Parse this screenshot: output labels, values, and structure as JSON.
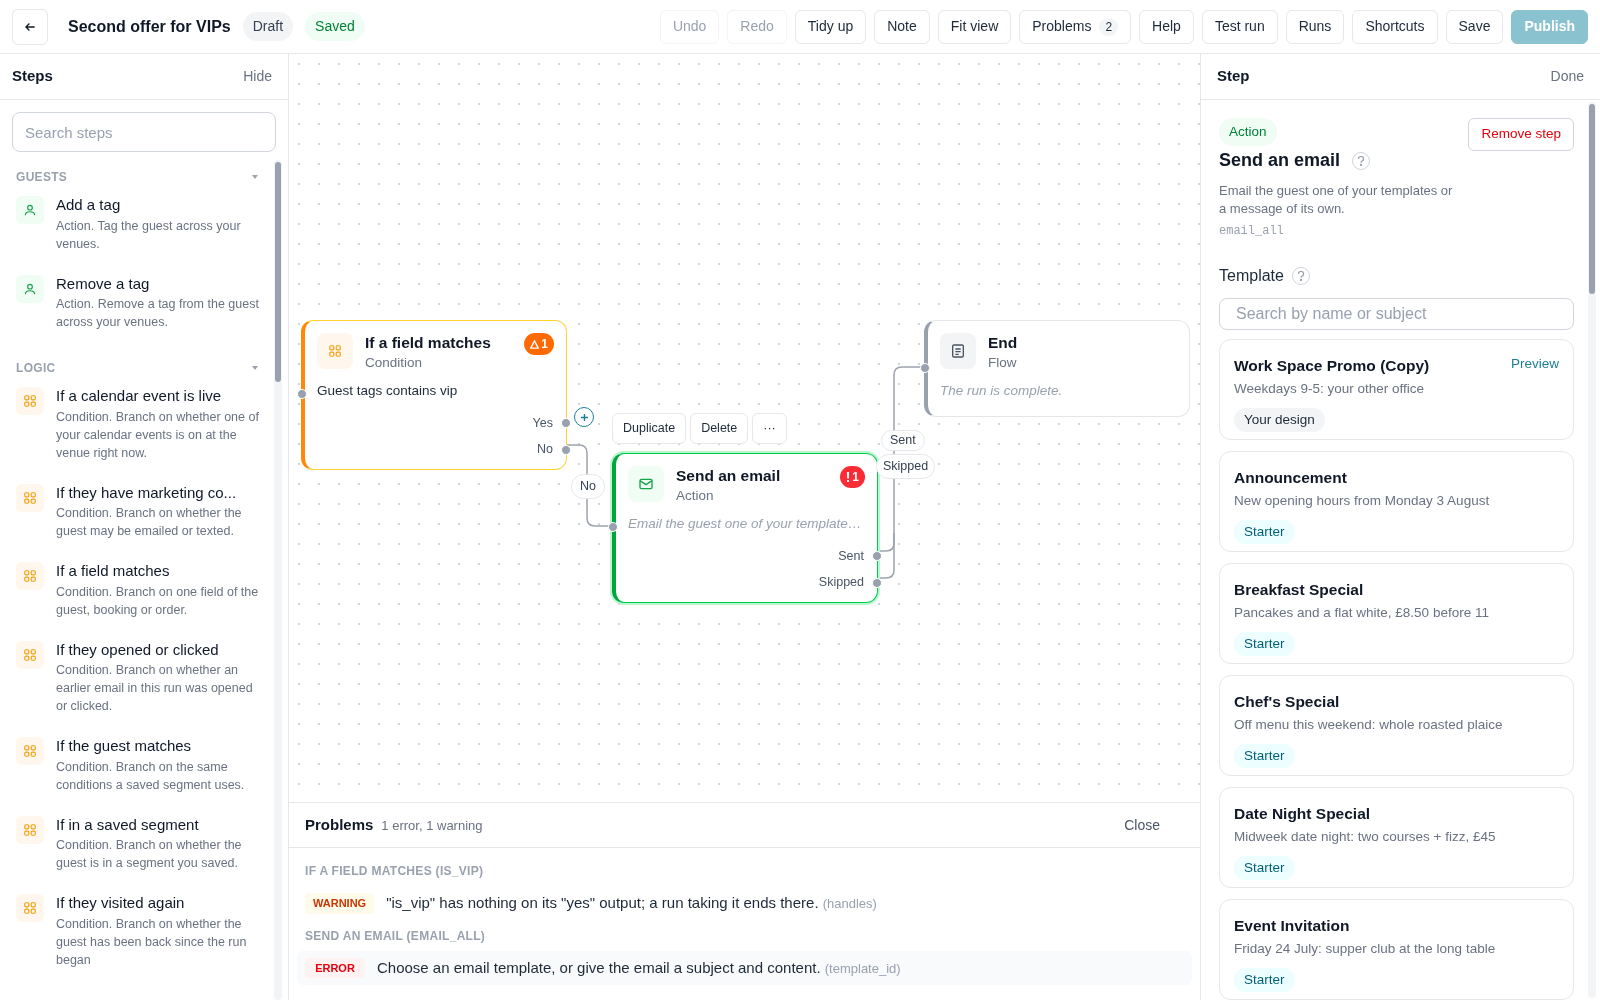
{
  "header": {
    "title": "Second offer for VIPs",
    "badges": [
      {
        "label": "Draft",
        "kind": "neutral"
      },
      {
        "label": "Saved",
        "kind": "success"
      }
    ],
    "buttons": [
      {
        "label": "Undo",
        "disabled": true
      },
      {
        "label": "Redo",
        "disabled": true
      },
      {
        "label": "Tidy up",
        "disabled": false
      },
      {
        "label": "Note",
        "disabled": false
      },
      {
        "label": "Fit view",
        "disabled": false
      },
      {
        "label": "Problems",
        "disabled": false,
        "count": "2"
      },
      {
        "label": "Help",
        "disabled": false
      },
      {
        "label": "Test run",
        "disabled": false
      },
      {
        "label": "Runs",
        "disabled": false
      },
      {
        "label": "Shortcuts",
        "disabled": false
      },
      {
        "label": "Save",
        "disabled": false
      },
      {
        "label": "Publish",
        "disabled": true,
        "kind": "primary"
      }
    ]
  },
  "sidebar": {
    "title": "Steps",
    "hide": "Hide",
    "search": {
      "placeholder": "Search steps"
    },
    "sections": [
      {
        "label": "GUESTS",
        "items": [
          {
            "kind": "action",
            "title": "Add a tag",
            "desc": "Action. Tag the guest across your venues."
          },
          {
            "kind": "action",
            "title": "Remove a tag",
            "desc": "Action. Remove a tag from the guest across your venues."
          }
        ]
      },
      {
        "label": "LOGIC",
        "items": [
          {
            "kind": "condition",
            "title": "If a calendar event is live",
            "desc": "Condition. Branch on whether one of your calendar events is on at the venue right now."
          },
          {
            "kind": "condition",
            "title": "If they have marketing co...",
            "desc": "Condition. Branch on whether the guest may be emailed or texted."
          },
          {
            "kind": "condition",
            "title": "If a field matches",
            "desc": "Condition. Branch on one field of the guest, booking or order."
          },
          {
            "kind": "condition",
            "title": "If they opened or clicked",
            "desc": "Condition. Branch on whether an earlier email in this run was opened or clicked."
          },
          {
            "kind": "condition",
            "title": "If the guest matches",
            "desc": "Condition. Branch on the same conditions a saved segment uses."
          },
          {
            "kind": "condition",
            "title": "If in a saved segment",
            "desc": "Condition. Branch on whether the guest is in a segment you saved."
          },
          {
            "kind": "condition",
            "title": "If they visited again",
            "desc": "Condition. Branch on whether the guest has been back since the run began"
          }
        ]
      }
    ]
  },
  "canvas": {
    "nodes": [
      {
        "kind": "condition",
        "title": "If a field matches",
        "subtitle": "Condition",
        "body": "Guest tags contains vip",
        "selected": false,
        "badge": {
          "kind": "warning",
          "count": "1"
        },
        "outputs": [
          "Yes",
          "No"
        ]
      },
      {
        "kind": "action",
        "title": "Send an email",
        "subtitle": "Action",
        "body": "Email the guest one of your template…",
        "selected": true,
        "badge": {
          "kind": "error",
          "count": "1"
        },
        "outputs": [
          "Sent",
          "Skipped"
        ]
      },
      {
        "kind": "flow",
        "title": "End",
        "subtitle": "Flow",
        "body": "The run is complete.",
        "selected": false
      }
    ],
    "node_toolbar": [
      "Duplicate",
      "Delete",
      "···"
    ],
    "edge_labels": [
      "No",
      "Sent",
      "Skipped"
    ]
  },
  "problems": {
    "title": "Problems",
    "summary": "1 error, 1 warning",
    "close": "Close",
    "groups": [
      {
        "heading": "IF A FIELD MATCHES (IS_VIP)",
        "items": [
          {
            "kind": "warning",
            "label": "WARNING",
            "message": "\"is_vip\" has nothing on its \"yes\" output; a run taking it ends there.",
            "field": "(handles)"
          }
        ]
      },
      {
        "heading": "SEND AN EMAIL (EMAIL_ALL)",
        "items": [
          {
            "kind": "error",
            "label": "ERROR",
            "message": "Choose an email template, or give the email a subject and content.",
            "field": "(template_id)"
          }
        ]
      }
    ]
  },
  "step": {
    "title": "Step",
    "done": "Done",
    "badge": "Action",
    "remove": "Remove step",
    "name": "Send an email",
    "desc": "Email the guest one of your templates or a message of its own.",
    "code": "email_all",
    "template_label": "Template",
    "search": {
      "placeholder": "Search by name or subject"
    },
    "templates": [
      {
        "name": "Work Space Promo (Copy)",
        "subject": "Weekdays 9-5: your other office",
        "tag": "Your design",
        "kind": "custom",
        "preview": "Preview"
      },
      {
        "name": "Announcement",
        "subject": "New opening hours from Monday 3 August",
        "tag": "Starter",
        "kind": "starter"
      },
      {
        "name": "Breakfast Special",
        "subject": "Pancakes and a flat white, £8.50 before 11",
        "tag": "Starter",
        "kind": "starter"
      },
      {
        "name": "Chef's Special",
        "subject": "Off menu this weekend: whole roasted plaice",
        "tag": "Starter",
        "kind": "starter"
      },
      {
        "name": "Date Night Special",
        "subject": "Midweek date night: two courses + fizz, £45",
        "tag": "Starter",
        "kind": "starter"
      },
      {
        "name": "Event Invitation",
        "subject": "Friday 24 July: supper club at the long table",
        "tag": "Starter",
        "kind": "starter"
      }
    ]
  }
}
